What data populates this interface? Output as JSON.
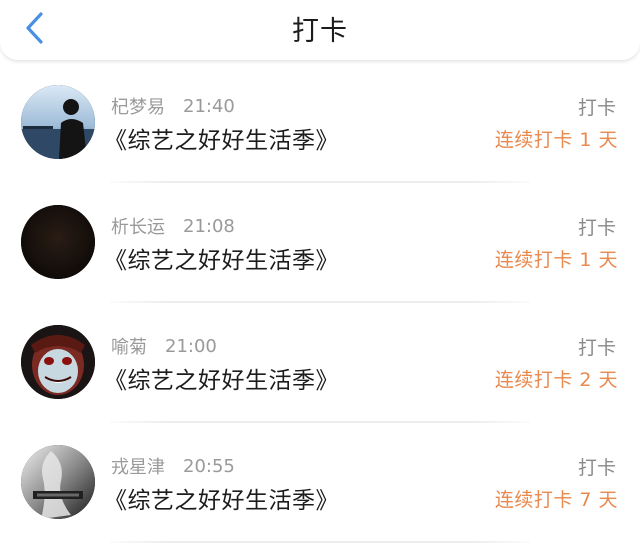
{
  "header": {
    "title": "打卡",
    "back_icon": "chevron-left-icon",
    "accent_color": "#4a90e2"
  },
  "checkins": [
    {
      "user": "杞梦易",
      "time": "21:40",
      "book": "《综艺之好好生活季》",
      "action": "打卡",
      "streak": "连续打卡 1 天"
    },
    {
      "user": "析长运",
      "time": "21:08",
      "book": "《综艺之好好生活季》",
      "action": "打卡",
      "streak": "连续打卡 1 天"
    },
    {
      "user": "喻菊",
      "time": "21:00",
      "book": "《综艺之好好生活季》",
      "action": "打卡",
      "streak": "连续打卡 2 天"
    },
    {
      "user": "戎星津",
      "time": "20:55",
      "book": "《综艺之好好生活季》",
      "action": "打卡",
      "streak": "连续打卡 7 天"
    }
  ],
  "colors": {
    "streak": "#e8894f",
    "meta": "#9a9a9a",
    "title": "#1c1c1e"
  }
}
